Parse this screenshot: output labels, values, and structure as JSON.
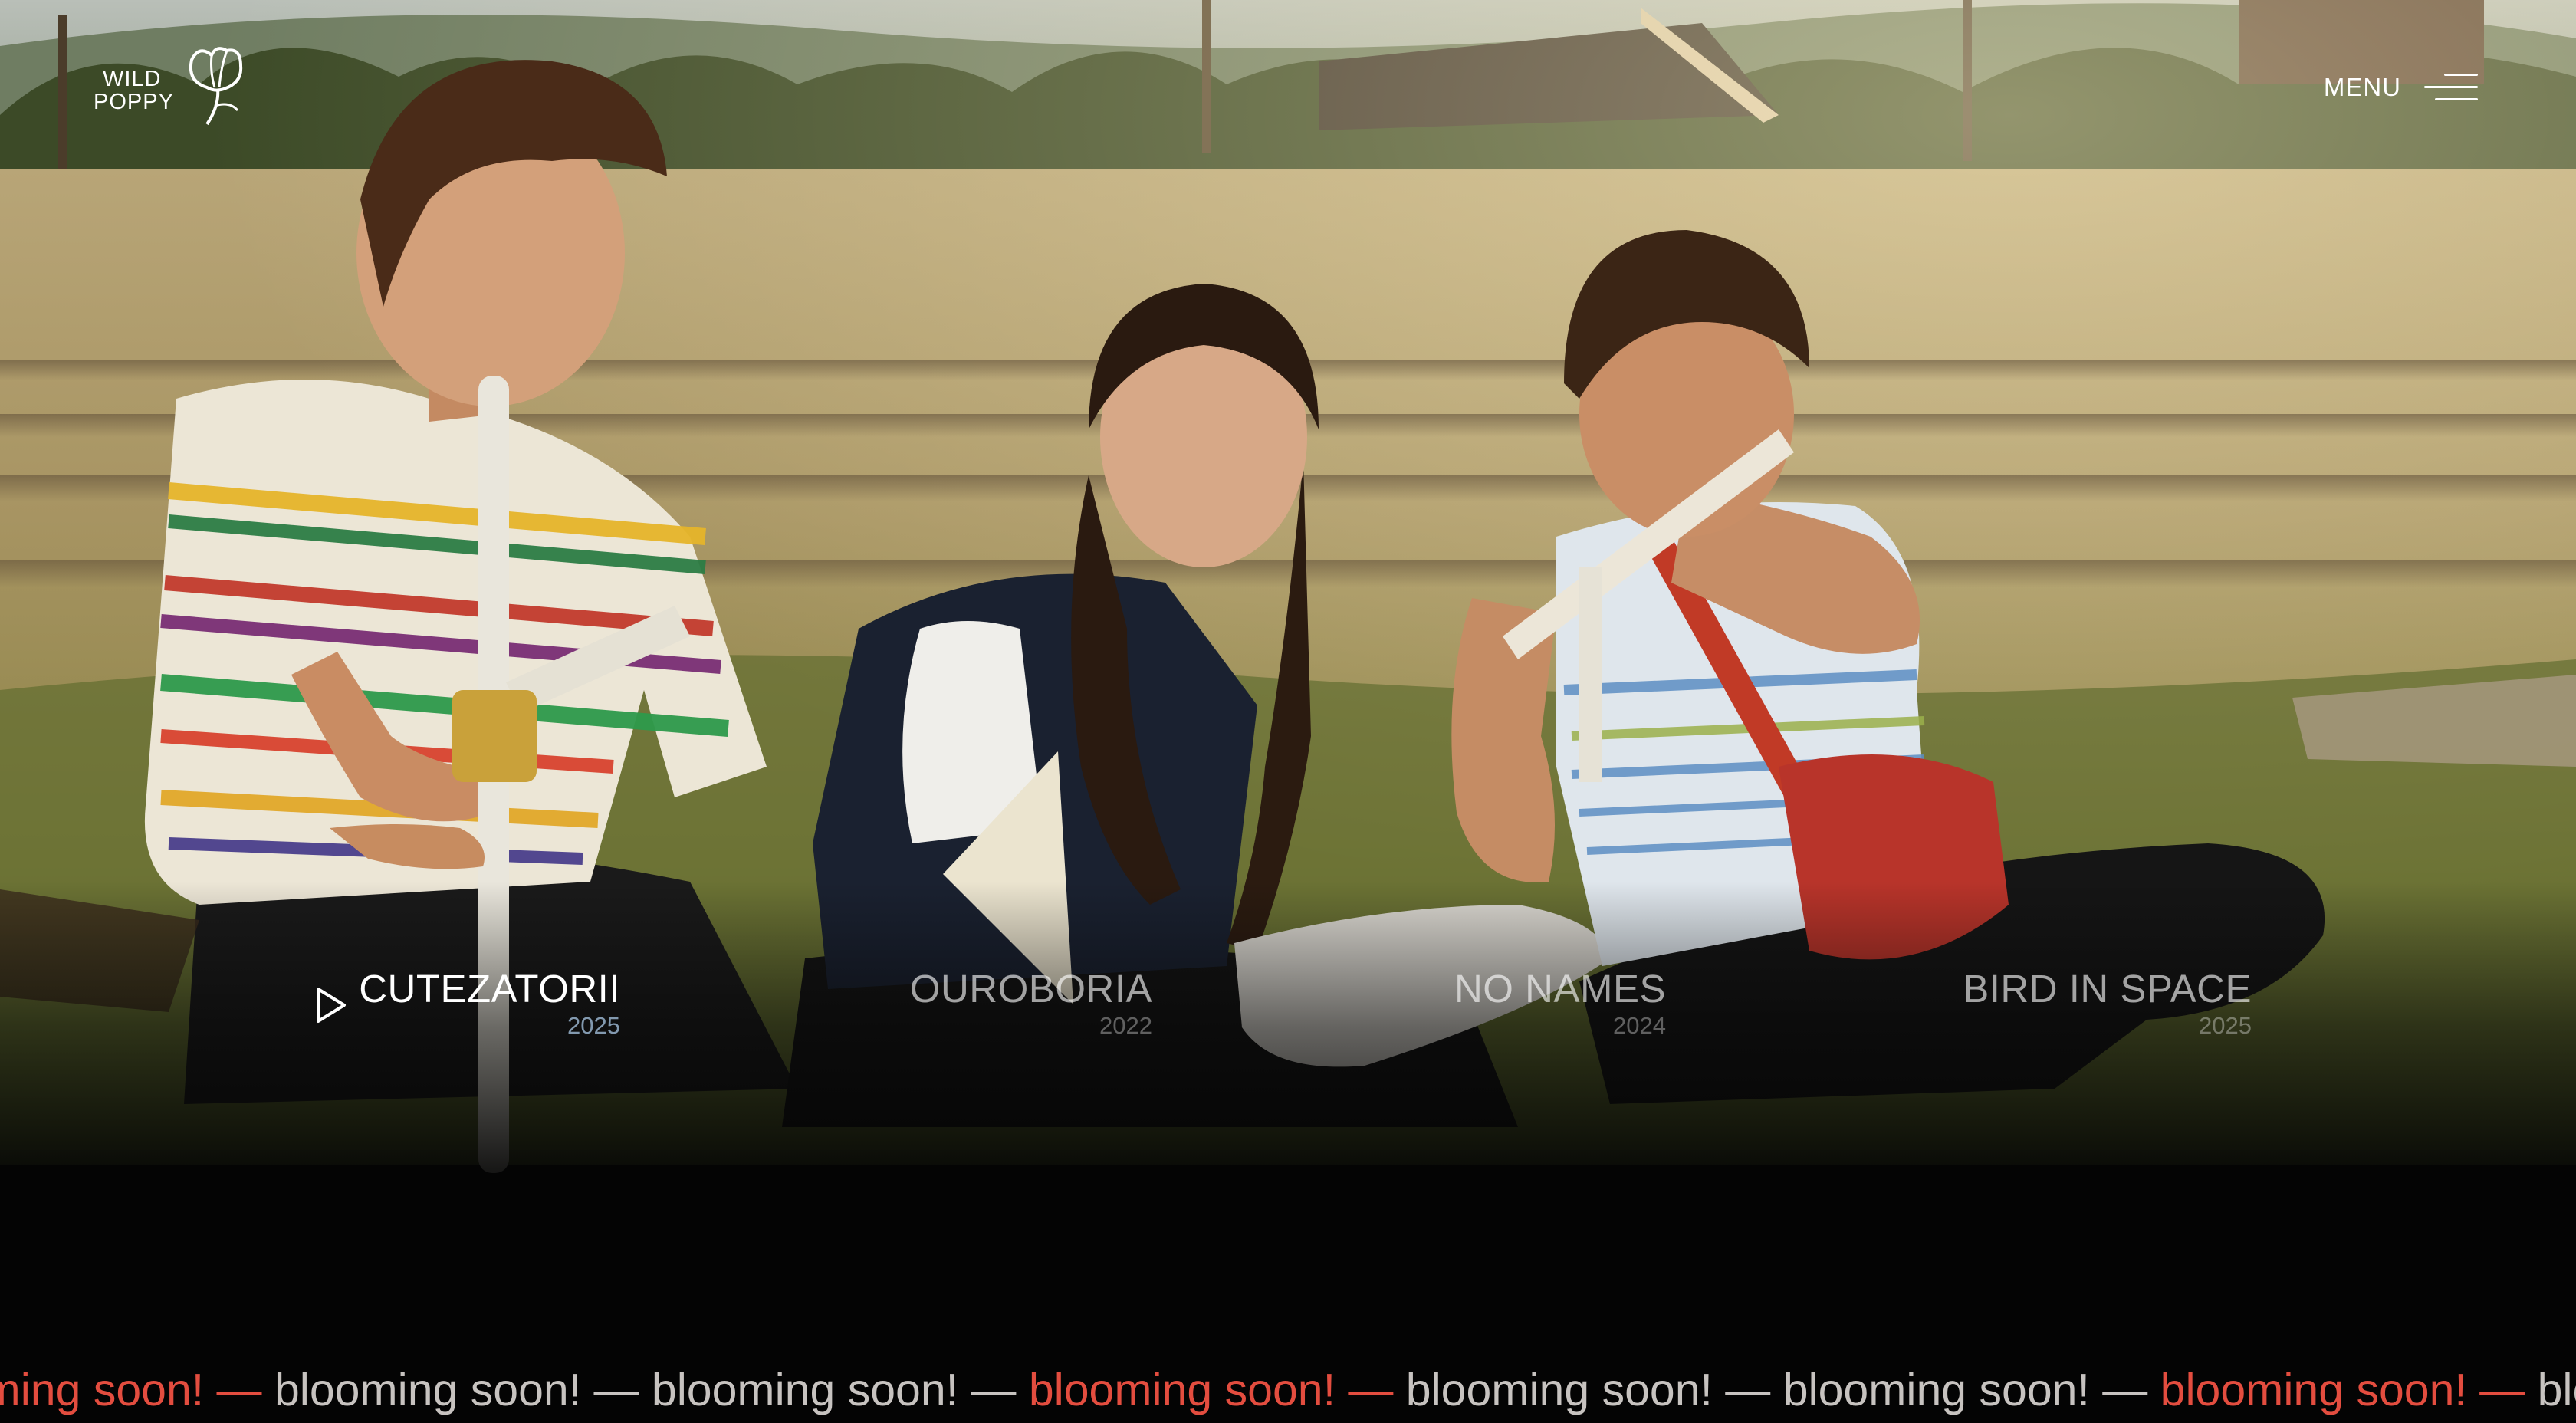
{
  "header": {
    "logo_line1": "WILD",
    "logo_line2": "POPPY",
    "menu_label": "MENU"
  },
  "films": [
    {
      "title": "CUTEZATORII",
      "year": "2025",
      "active": true
    },
    {
      "title": "OUROBORIA",
      "year": "2022",
      "active": false
    },
    {
      "title": "NO NAMES",
      "year": "2024",
      "active": false
    },
    {
      "title": "BIRD IN SPACE",
      "year": "2025",
      "active": false
    }
  ],
  "marquee": {
    "items": [
      {
        "text": "blooming soon! —",
        "color": "#e34d3f"
      },
      {
        "text": "blooming soon! —",
        "color": "#c7c3c0"
      },
      {
        "text": "blooming soon! —",
        "color": "#c7c3c0"
      },
      {
        "text": "blooming soon! —",
        "color": "#e34d3f"
      },
      {
        "text": "blooming soon! —",
        "color": "#c7c3c0"
      },
      {
        "text": "blooming soon! —",
        "color": "#c7c3c0"
      },
      {
        "text": "blooming soon! —",
        "color": "#e34d3f"
      },
      {
        "text": "blooming soon!",
        "color": "#c7c3c0"
      }
    ]
  },
  "colors": {
    "accent_red": "#e34d3f",
    "background": "#040404",
    "text_white": "#ffffff"
  },
  "icons": {
    "logo": "poppy-flower-icon",
    "menu": "hamburger-menu-icon",
    "active_film": "play-triangle-icon"
  }
}
